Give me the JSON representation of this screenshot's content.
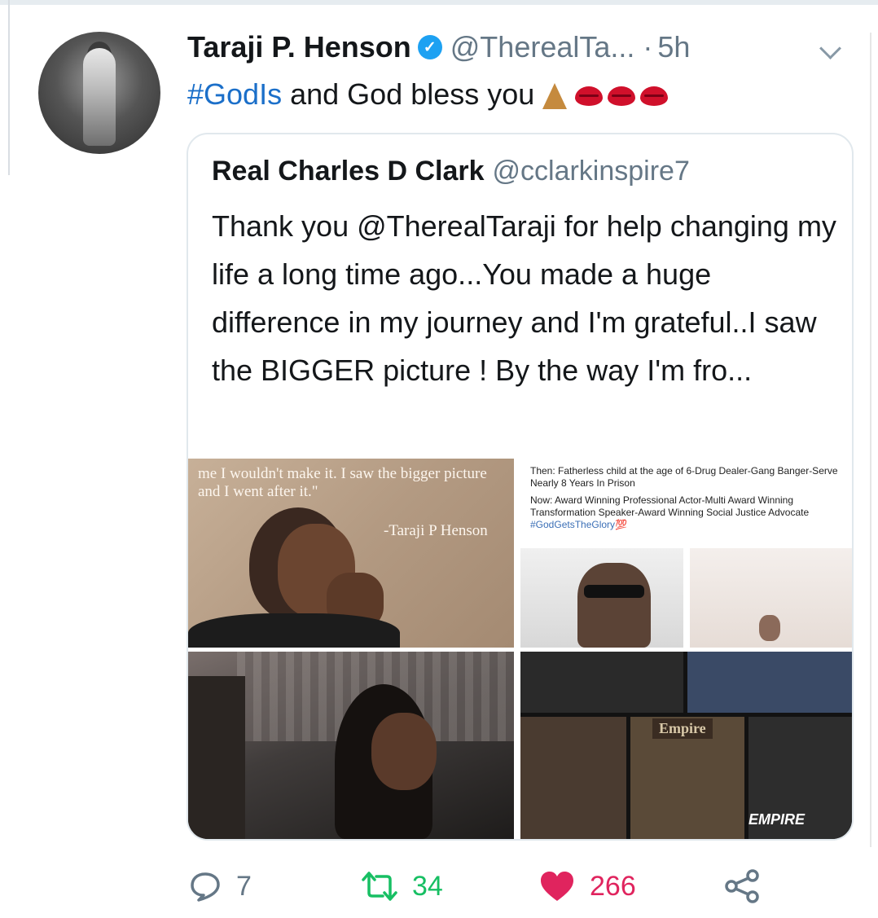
{
  "tweet": {
    "author_name": "Taraji P. Henson",
    "author_handle": "@TherealTa...",
    "separator": "·",
    "time": "5h",
    "hashtag": "#GodIs",
    "text_rest": " and God bless you",
    "emojis": [
      "praying-hands",
      "kiss-mark",
      "kiss-mark",
      "kiss-mark"
    ]
  },
  "quoted_tweet": {
    "author_name": "Real Charles D Clark",
    "author_handle": "@cclarkinspire7",
    "text": "Thank you @TherealTaraji for help changing my life a long time ago...You made a huge difference in my journey and I'm grateful..I saw the BIGGER picture ! By the way I'm fro...",
    "media": {
      "quote_card": {
        "quote": "me I wouldn't make it. I saw the bigger picture and I went after it.\"",
        "author": "-Taraji P Henson"
      },
      "bio_card": {
        "then": "Then: Fatherless child at the age of 6-Drug Dealer-Gang Banger-Serve Nearly 8 Years In Prison",
        "now": "Now: Award Winning Professional Actor-Multi Award Winning Transformation Speaker-Award Winning Social Justice Advocate",
        "hashtag": "#GodGetsTheGlory💯"
      },
      "collage_labels": [
        "Empire",
        "EMPIRE"
      ]
    }
  },
  "actions": {
    "reply_count": "7",
    "retweet_count": "34",
    "like_count": "266"
  },
  "colors": {
    "link": "#1b6fc9",
    "verified": "#1da1f2",
    "retweet": "#17bf63",
    "like": "#e0245e",
    "muted": "#657786"
  }
}
